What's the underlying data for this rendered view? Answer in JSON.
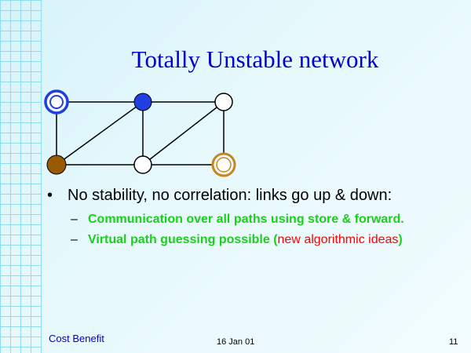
{
  "slide": {
    "title": "Totally Unstable network",
    "bullet_marker": "•",
    "bullet_text": "No stability, no correlation: links go up & down:",
    "sub_items": [
      {
        "dash": "–",
        "text": "Communication over all paths using store & forward."
      },
      {
        "dash": "–",
        "text_before": "Virtual path guessing possible (",
        "text_red": "new algorithmic ideas",
        "text_after": ")"
      }
    ]
  },
  "footer": {
    "left": "Cost Benefit",
    "center": "16 Jan 01",
    "right": "11"
  },
  "colors": {
    "title": "#0000cc",
    "grid_line": "#8fdcf0",
    "sub_bullet_text": "#1ccf1c",
    "highlight_red": "#ff0000",
    "node_blue": "#1f3fe0",
    "node_brown": "#9a5a05",
    "node_gold_ring": "#c8851c"
  }
}
